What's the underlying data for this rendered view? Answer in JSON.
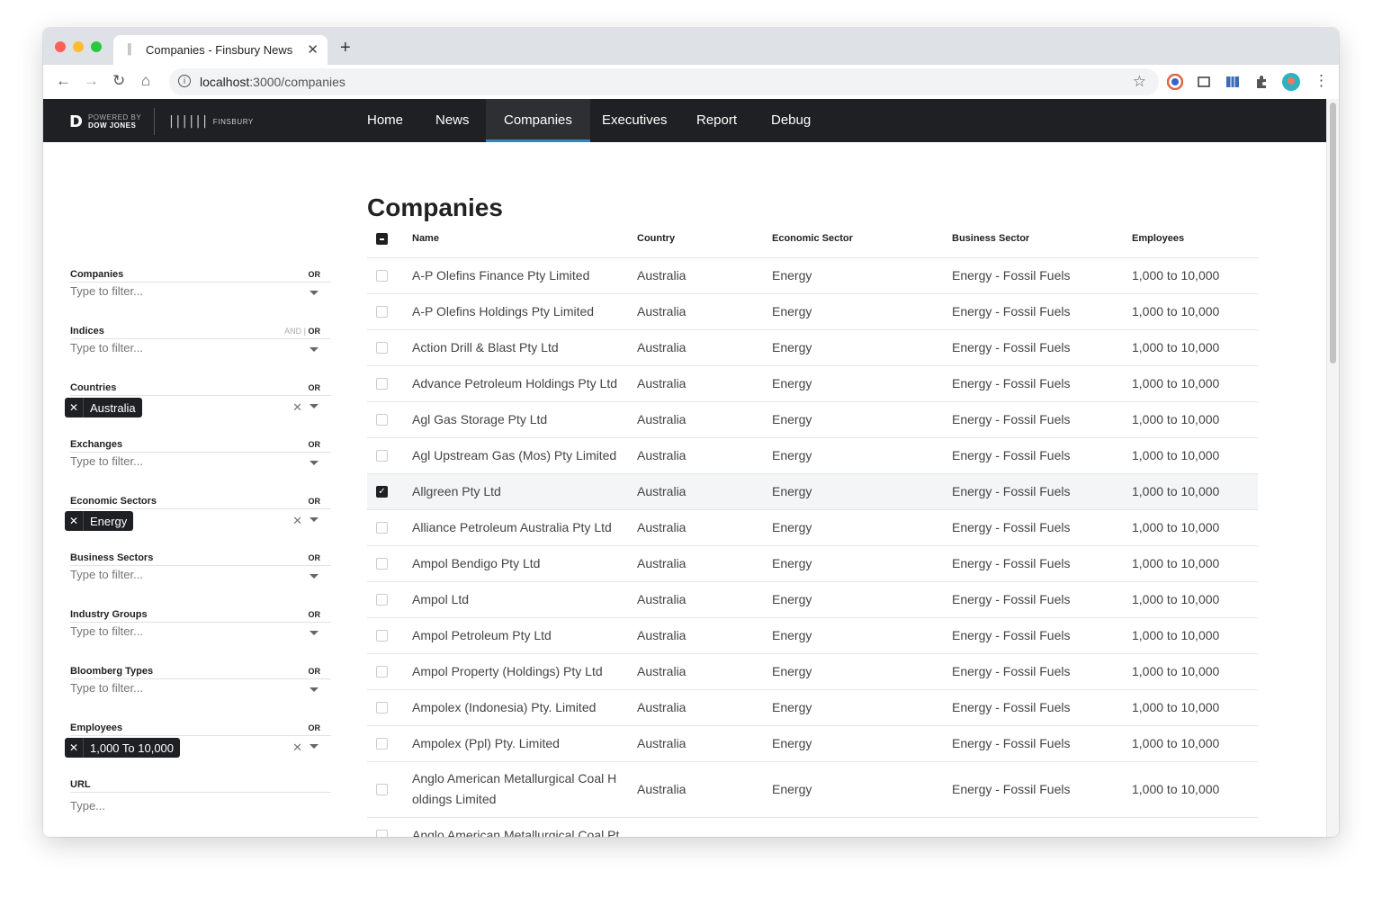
{
  "browser": {
    "tab_title": "Companies - Finsbury News",
    "url_host": "localhost",
    "url_path": ":3000/companies"
  },
  "logo": {
    "powered_by": "POWERED BY",
    "dow_jones": "DOW JONES",
    "finsbury": "FINSBURY"
  },
  "nav": {
    "items": [
      {
        "label": "Home"
      },
      {
        "label": "News"
      },
      {
        "label": "Companies"
      },
      {
        "label": "Executives"
      },
      {
        "label": "Report"
      },
      {
        "label": "Debug"
      }
    ],
    "active": "Companies"
  },
  "filters": [
    {
      "label": "Companies",
      "op_and": "",
      "op": "OR",
      "placeholder": "Type to filter...",
      "chip": ""
    },
    {
      "label": "Indices",
      "op_and": "AND",
      "op": "OR",
      "placeholder": "Type to filter...",
      "chip": ""
    },
    {
      "label": "Countries",
      "op_and": "",
      "op": "OR",
      "placeholder": "",
      "chip": "Australia"
    },
    {
      "label": "Exchanges",
      "op_and": "",
      "op": "OR",
      "placeholder": "Type to filter...",
      "chip": ""
    },
    {
      "label": "Economic Sectors",
      "op_and": "",
      "op": "OR",
      "placeholder": "",
      "chip": "Energy"
    },
    {
      "label": "Business Sectors",
      "op_and": "",
      "op": "OR",
      "placeholder": "Type to filter...",
      "chip": ""
    },
    {
      "label": "Industry Groups",
      "op_and": "",
      "op": "OR",
      "placeholder": "Type to filter...",
      "chip": ""
    },
    {
      "label": "Bloomberg Types",
      "op_and": "",
      "op": "OR",
      "placeholder": "Type to filter...",
      "chip": ""
    },
    {
      "label": "Employees",
      "op_and": "",
      "op": "OR",
      "placeholder": "",
      "chip": "1,000 To 10,000"
    }
  ],
  "url_filter": {
    "label": "URL",
    "placeholder": "Type..."
  },
  "page": {
    "title": "Companies"
  },
  "table": {
    "columns": [
      "Name",
      "Country",
      "Economic Sector",
      "Business Sector",
      "Employees"
    ],
    "rows": [
      {
        "name": "A-P Olefins Finance Pty Limited",
        "name2": "",
        "country": "Australia",
        "esec": "Energy",
        "bsec": "Energy - Fossil Fuels",
        "emp": "1,000 to 10,000",
        "checked": false
      },
      {
        "name": "A-P Olefins Holdings Pty Limited",
        "name2": "",
        "country": "Australia",
        "esec": "Energy",
        "bsec": "Energy - Fossil Fuels",
        "emp": "1,000 to 10,000",
        "checked": false
      },
      {
        "name": "Action Drill & Blast Pty Ltd",
        "name2": "",
        "country": "Australia",
        "esec": "Energy",
        "bsec": "Energy - Fossil Fuels",
        "emp": "1,000 to 10,000",
        "checked": false
      },
      {
        "name": "Advance Petroleum Holdings Pty Ltd",
        "name2": "",
        "country": "Australia",
        "esec": "Energy",
        "bsec": "Energy - Fossil Fuels",
        "emp": "1,000 to 10,000",
        "checked": false
      },
      {
        "name": "Agl Gas Storage Pty Ltd",
        "name2": "",
        "country": "Australia",
        "esec": "Energy",
        "bsec": "Energy - Fossil Fuels",
        "emp": "1,000 to 10,000",
        "checked": false
      },
      {
        "name": "Agl Upstream Gas (Mos) Pty Limited",
        "name2": "",
        "country": "Australia",
        "esec": "Energy",
        "bsec": "Energy - Fossil Fuels",
        "emp": "1,000 to 10,000",
        "checked": false
      },
      {
        "name": "Allgreen Pty Ltd",
        "name2": "",
        "country": "Australia",
        "esec": "Energy",
        "bsec": "Energy - Fossil Fuels",
        "emp": "1,000 to 10,000",
        "checked": true
      },
      {
        "name": "Alliance Petroleum Australia Pty Ltd",
        "name2": "",
        "country": "Australia",
        "esec": "Energy",
        "bsec": "Energy - Fossil Fuels",
        "emp": "1,000 to 10,000",
        "checked": false
      },
      {
        "name": "Ampol Bendigo Pty Ltd",
        "name2": "",
        "country": "Australia",
        "esec": "Energy",
        "bsec": "Energy - Fossil Fuels",
        "emp": "1,000 to 10,000",
        "checked": false
      },
      {
        "name": "Ampol Ltd",
        "name2": "",
        "country": "Australia",
        "esec": "Energy",
        "bsec": "Energy - Fossil Fuels",
        "emp": "1,000 to 10,000",
        "checked": false
      },
      {
        "name": "Ampol Petroleum Pty Ltd",
        "name2": "",
        "country": "Australia",
        "esec": "Energy",
        "bsec": "Energy - Fossil Fuels",
        "emp": "1,000 to 10,000",
        "checked": false
      },
      {
        "name": "Ampol Property (Holdings) Pty Ltd",
        "name2": "",
        "country": "Australia",
        "esec": "Energy",
        "bsec": "Energy - Fossil Fuels",
        "emp": "1,000 to 10,000",
        "checked": false
      },
      {
        "name": "Ampolex (Indonesia) Pty. Limited",
        "name2": "",
        "country": "Australia",
        "esec": "Energy",
        "bsec": "Energy - Fossil Fuels",
        "emp": "1,000 to 10,000",
        "checked": false
      },
      {
        "name": "Ampolex (Ppl) Pty. Limited",
        "name2": "",
        "country": "Australia",
        "esec": "Energy",
        "bsec": "Energy - Fossil Fuels",
        "emp": "1,000 to 10,000",
        "checked": false
      },
      {
        "name": "Anglo American Metallurgical Coal H",
        "name2": "oldings Limited",
        "country": "Australia",
        "esec": "Energy",
        "bsec": "Energy - Fossil Fuels",
        "emp": "1,000 to 10,000",
        "checked": false
      },
      {
        "name": "Anglo American Metallurgical Coal Pt",
        "name2": "",
        "country": "",
        "esec": "",
        "bsec": "",
        "emp": "",
        "checked": false
      }
    ]
  }
}
